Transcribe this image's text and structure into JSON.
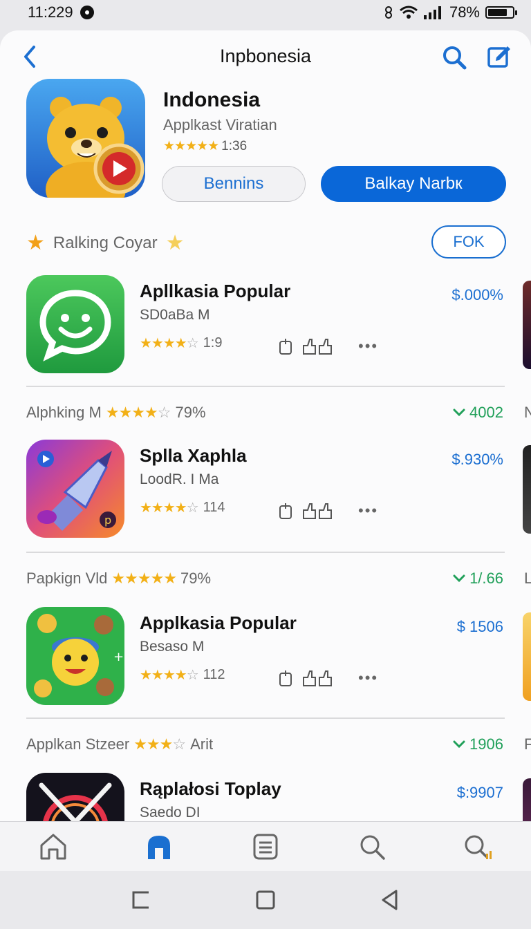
{
  "status": {
    "time": "11:229",
    "battery": "78%",
    "battery_level": 0.78
  },
  "nav": {
    "title": "Inpbonesia"
  },
  "hero": {
    "name": "Indonesia",
    "subtitle": "Applkast Viratian",
    "stars": "★★★★★",
    "rating_text": "1:36",
    "btn_secondary": "Bennins",
    "btn_primary": "Balkay Narbк"
  },
  "ranking": {
    "label": "Ralking Coyar",
    "action": "FOK"
  },
  "apps": [
    {
      "name": "Apllkasia Popular",
      "developer": "SD0aBa M",
      "stars": "★★★★",
      "empty": "☆",
      "count": "1:9",
      "price": "$.000%"
    },
    {
      "name": "Splla Xaphla",
      "developer": "LoodR. I Ma",
      "stars": "★★★★",
      "empty": "☆",
      "count": "114",
      "price": "$.930%"
    },
    {
      "name": "Applkasia Popular",
      "developer": "Besaso M",
      "stars": "★★★★",
      "empty": "☆",
      "count": "112",
      "price": "$ 1506"
    },
    {
      "name": "Rąplałosi Toplay",
      "developer": "Saedo DI",
      "price": "$:9907"
    }
  ],
  "sections": [
    {
      "label": "Alphking M",
      "stars": "★★★★",
      "tail": "☆",
      "pct": "79%",
      "trend": "4002",
      "peek": "N"
    },
    {
      "label": "Papkign Vld",
      "stars": "★★★★★",
      "tail": "",
      "pct": "79%",
      "trend": "1/.66",
      "peek": "L"
    },
    {
      "label": "Applkan Stzeer",
      "stars": "★★★",
      "tail": "☆",
      "pct": "Arit",
      "trend": "1906",
      "peek": "F"
    }
  ],
  "colors": {
    "accent": "#0a67d8",
    "link": "#1c6fd1",
    "star": "#f2b017",
    "trend": "#21a05a"
  }
}
